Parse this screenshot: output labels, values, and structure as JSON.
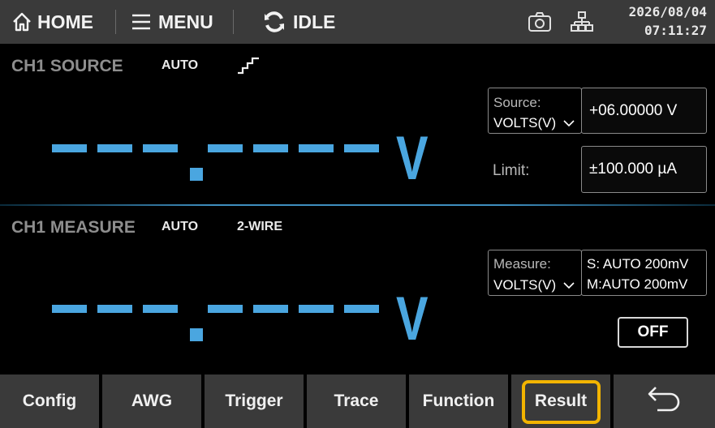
{
  "topbar": {
    "home_label": "HOME",
    "menu_label": "MENU",
    "status_label": "IDLE",
    "date": "2026/08/04",
    "time": "07:11:27"
  },
  "source": {
    "title": "CH1 SOURCE",
    "range_mode": "AUTO",
    "readout_unit": "V",
    "function_label": "Source:",
    "function_value": "VOLTS(V)",
    "level_value": "+06.00000 V",
    "limit_label": "Limit:",
    "limit_value": "±100.000 µA"
  },
  "measure": {
    "title": "CH1 MEASURE",
    "range_mode": "AUTO",
    "wire_mode": "2-WIRE",
    "readout_unit": "V",
    "function_label": "Measure:",
    "function_value": "VOLTS(V)",
    "range_s": "S:  AUTO 200mV",
    "range_m": "M:AUTO 200mV",
    "output_state": "OFF"
  },
  "softkeys": [
    "Config",
    "AWG",
    "Trigger",
    "Trace",
    "Function",
    "Result"
  ],
  "colors": {
    "accent_blue": "#4aa6e0",
    "highlight": "#f2b400",
    "bar_gray": "#3a3a3a"
  }
}
